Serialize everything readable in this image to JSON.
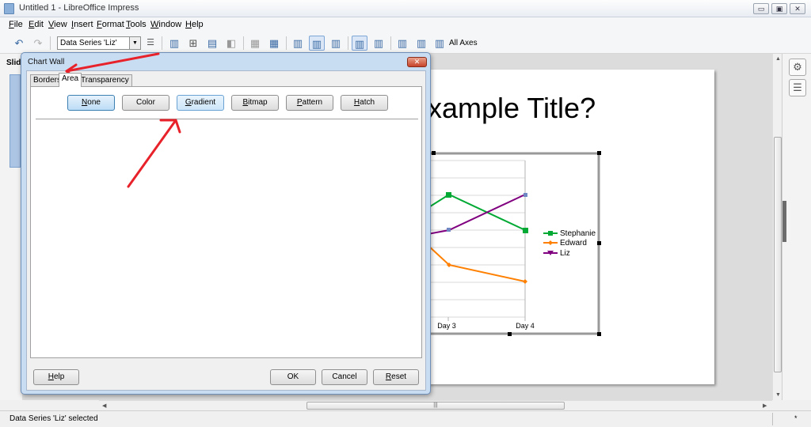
{
  "window": {
    "title": "Untitled 1 - LibreOffice Impress",
    "minimize": "▭",
    "restore": "▣",
    "close": "✕"
  },
  "menu": [
    "File",
    "Edit",
    "View",
    "Insert",
    "Format",
    "Tools",
    "Window",
    "Help"
  ],
  "toolbar": {
    "series_select": "Data Series 'Liz'",
    "all_axes_label": "All Axes"
  },
  "slide_pane": {
    "label": "Slide"
  },
  "slide": {
    "title_visible": "xample Title?"
  },
  "chart_data": {
    "type": "line",
    "x": [
      "Day 3",
      "Day 4"
    ],
    "series": [
      {
        "name": "Stephanie",
        "color": "#00a933",
        "marker": "square"
      },
      {
        "name": "Edward",
        "color": "#ff8000",
        "marker": "diamond"
      },
      {
        "name": "Liz",
        "color": "#800080",
        "marker": "triangle-down"
      }
    ]
  },
  "dialog": {
    "title": "Chart Wall",
    "close_glyph": "✕",
    "tabs": [
      "Borders",
      "Area",
      "Transparency"
    ],
    "active_tab": "Area",
    "fill_buttons": [
      {
        "ul": "N",
        "rest": "one",
        "state": "selected"
      },
      {
        "ul": "",
        "rest": "Color",
        "state": "normal"
      },
      {
        "ul": "G",
        "rest": "radient",
        "state": "hovered"
      },
      {
        "ul": "B",
        "rest": "itmap",
        "state": "normal"
      },
      {
        "ul": "P",
        "rest": "attern",
        "state": "normal"
      },
      {
        "ul": "H",
        "rest": "atch",
        "state": "normal"
      }
    ],
    "buttons": {
      "help_ul": "H",
      "help_rest": "elp",
      "ok": "OK",
      "cancel": "Cancel",
      "reset_ul": "R",
      "reset_rest": "eset"
    }
  },
  "status": {
    "text": "Data Series 'Liz' selected",
    "mark": "*"
  },
  "colors": {
    "annotation_red": "#e8222a",
    "accent_blue": "#3c7fb1"
  }
}
